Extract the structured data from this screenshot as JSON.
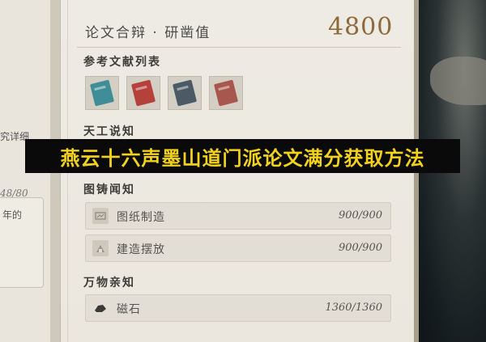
{
  "left_panel": {
    "text_top": "究详细",
    "text_counter": "48/80",
    "text_bottom": "年的"
  },
  "header": {
    "title": "论文合辩 · 研凿值",
    "score": "4800"
  },
  "sections": {
    "references": "参考文献列表",
    "tiangong": "天工说知",
    "tuzhu": "图铸闻知",
    "wanwu": "万物亲知"
  },
  "books": [
    {
      "name": "book-teal",
      "color": "#3f8d96"
    },
    {
      "name": "book-red",
      "color": "#b5413b"
    },
    {
      "name": "book-slate",
      "color": "#4c5a66"
    },
    {
      "name": "book-rose",
      "color": "#a8574e"
    }
  ],
  "rows": {
    "blueprint": {
      "label": "图纸制造",
      "progress": "900/900"
    },
    "build": {
      "label": "建造摆放",
      "progress": "900/900"
    },
    "magnet": {
      "label": "磁石",
      "progress": "1360/1360"
    }
  },
  "banner": {
    "text": "燕云十六声墨山道门派论文满分获取方法",
    "color": "#f2d21f"
  }
}
